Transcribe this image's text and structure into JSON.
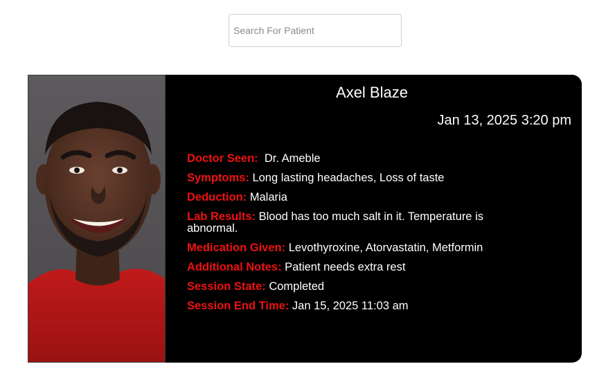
{
  "search": {
    "placeholder": "Search For Patient",
    "value": ""
  },
  "patient": {
    "name": "Axel Blaze",
    "date": "Jan 13, 2025 3:20 pm",
    "photo_icon": "person-photo"
  },
  "fields": [
    {
      "label": "Doctor Seen:",
      "value": " Dr. Ameble"
    },
    {
      "label": "Symptoms:",
      "value": "Long lasting headaches, Loss of taste"
    },
    {
      "label": "Deduction:",
      "value": "Malaria"
    },
    {
      "label": "Lab Results:",
      "value": "Blood has too much salt in it. Temperature is abnormal."
    },
    {
      "label": "Medication Given:",
      "value": "Levothyroxine, Atorvastatin, Metformin"
    },
    {
      "label": "Additional Notes:",
      "value": "Patient needs extra rest"
    },
    {
      "label": "Session State:",
      "value": "Completed"
    },
    {
      "label": "Session End Time:",
      "value": "Jan 15, 2025 11:03 am"
    }
  ],
  "colors": {
    "card_background": "#000000",
    "label_color": "#ee1111",
    "value_color": "#ffffff"
  }
}
